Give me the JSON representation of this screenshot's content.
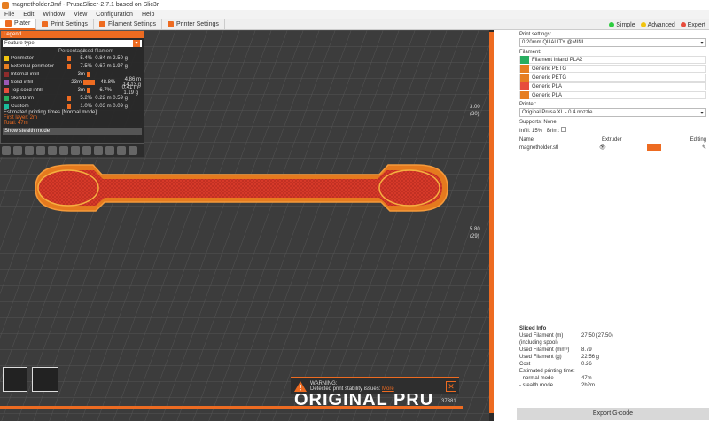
{
  "window": {
    "title": "magnetholder.3mf - PrusaSlicer-2.7.1 based on Slic3r"
  },
  "menu": [
    "File",
    "Edit",
    "Window",
    "View",
    "Configuration",
    "Help"
  ],
  "tabs": [
    "Plater",
    "Print Settings",
    "Filament Settings",
    "Printer Settings"
  ],
  "modes": [
    {
      "label": "Simple",
      "color": "#2ecc40"
    },
    {
      "label": "Advanced",
      "color": "#f1c40f"
    },
    {
      "label": "Expert",
      "color": "#e74c3c"
    }
  ],
  "legend": {
    "header": "Legend",
    "view_type": "Feature type",
    "col_headers": [
      "",
      "Percentage",
      "Used filament"
    ],
    "rows": [
      {
        "name": "Perimeter",
        "time": "",
        "pct": "5.4%",
        "used": "0.84 m  2.50 g",
        "color": "#f1c40f"
      },
      {
        "name": "External perimeter",
        "time": "",
        "pct": "7.5%",
        "used": "0.67 m  1.97 g",
        "color": "#e67e22"
      },
      {
        "name": "Internal infill",
        "time": "3m",
        "pct": "",
        "used": "",
        "color": "#8e2c2c"
      },
      {
        "name": "Solid infill",
        "time": "23m",
        "pct": "48.8%",
        "used": "4.86 m  14.13 g",
        "color": "#9b59b6"
      },
      {
        "name": "Top solid infill",
        "time": "3m",
        "pct": "6.7%",
        "used": "0.41 m  1.19 g",
        "color": "#e74c3c"
      },
      {
        "name": "Skirt/Brim",
        "time": "",
        "pct": "5.2%",
        "used": "0.22 m  0.59 g",
        "color": "#27ae60"
      },
      {
        "name": "Custom",
        "time": "",
        "pct": "1.0%",
        "used": "0.03 m  0.09 g",
        "color": "#1abc9c"
      }
    ],
    "estimated_label": "Estimated printing times [Normal mode]:",
    "first_layer": "First layer: 2m",
    "total": "Total: 47m",
    "show_stealth": "Show stealth mode"
  },
  "viewport": {
    "brand_text": "ORIGINAL PRU",
    "layer_top": "3.00",
    "layer_top_sub": "(30)",
    "layer_mid": "5.80",
    "layer_mid_sub": "(29)",
    "h_value": "37381"
  },
  "warning": {
    "title": "WARNING:",
    "message": "Detected print stability issues:",
    "link": "More"
  },
  "sidepanel": {
    "print_settings_label": "Print settings:",
    "print_settings_value": "0.20mm QUALITY @MINI",
    "filament_label": "Filament:",
    "filaments": [
      {
        "name": "Filament Inland PLA2",
        "color": "#27ae60"
      },
      {
        "name": "Generic PETG",
        "color": "#e67e22"
      },
      {
        "name": "Generic PETG",
        "color": "#e67e22"
      },
      {
        "name": "Generic PLA",
        "color": "#e74c3c"
      },
      {
        "name": "Generic PLA",
        "color": "#e67e22"
      }
    ],
    "printer_label": "Printer:",
    "printer_value": "Original Prusa XL - 0.4 nozzle",
    "supports_label": "Supports:",
    "supports_value": "None",
    "infill_label": "Infill:",
    "infill_value": "15%",
    "brim_label": "Brim:",
    "col_name": "Name",
    "col_extruder": "Extruder",
    "col_editing": "Editing",
    "object_name": "magnetholder.stl",
    "sliced_info_label": "Sliced Info",
    "sliced": [
      {
        "k": "Used Filament (m)",
        "v": "27.50 (27.50)"
      },
      {
        "k": "(including spool)",
        "v": ""
      },
      {
        "k": "Used Filament (mm³)",
        "v": "8.79"
      },
      {
        "k": "Used Filament (g)",
        "v": "22.56 g"
      },
      {
        "k": "Cost",
        "v": "0.26"
      },
      {
        "k": "Estimated printing time:",
        "v": ""
      },
      {
        "k": "- normal mode",
        "v": "47m"
      },
      {
        "k": "- stealth mode",
        "v": "2h2m"
      }
    ],
    "export_label": "Export G-code"
  }
}
